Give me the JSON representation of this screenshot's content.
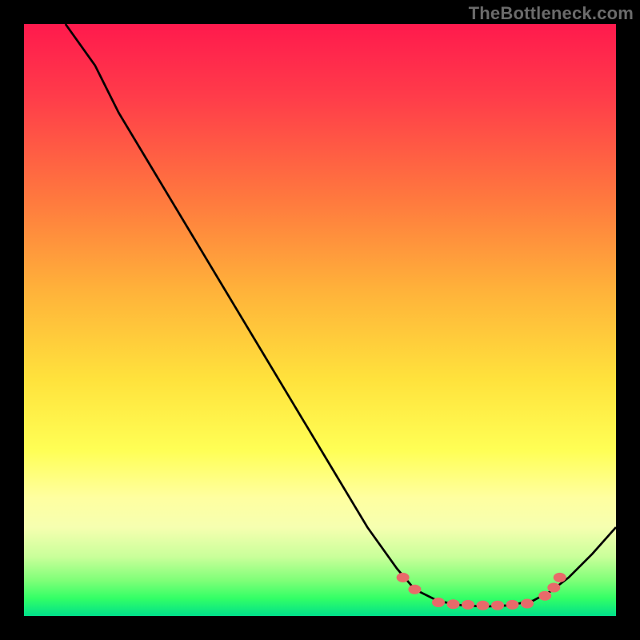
{
  "watermark": "TheBottleneck.com",
  "colors": {
    "curve": "#000000",
    "dot": "#e86a6a",
    "gradient_top": "#ff1a4d",
    "gradient_bottom": "#00e08a"
  },
  "chart_data": {
    "type": "line",
    "title": "",
    "xlabel": "",
    "ylabel": "",
    "xlim": [
      0,
      100
    ],
    "ylim": [
      0,
      100
    ],
    "curve": [
      {
        "x": 7,
        "y": 100
      },
      {
        "x": 12,
        "y": 93
      },
      {
        "x": 16,
        "y": 85
      },
      {
        "x": 22,
        "y": 75
      },
      {
        "x": 28,
        "y": 65
      },
      {
        "x": 34,
        "y": 55
      },
      {
        "x": 40,
        "y": 45
      },
      {
        "x": 46,
        "y": 35
      },
      {
        "x": 52,
        "y": 25
      },
      {
        "x": 58,
        "y": 15
      },
      {
        "x": 63,
        "y": 8
      },
      {
        "x": 66,
        "y": 4.5
      },
      {
        "x": 70,
        "y": 2.5
      },
      {
        "x": 74,
        "y": 1.8
      },
      {
        "x": 78,
        "y": 1.6
      },
      {
        "x": 82,
        "y": 1.8
      },
      {
        "x": 86,
        "y": 2.6
      },
      {
        "x": 89,
        "y": 4.2
      },
      {
        "x": 92,
        "y": 6.5
      },
      {
        "x": 96,
        "y": 10.5
      },
      {
        "x": 100,
        "y": 15
      }
    ],
    "dots": [
      {
        "x": 64,
        "y": 6.5
      },
      {
        "x": 66,
        "y": 4.5
      },
      {
        "x": 70,
        "y": 2.3
      },
      {
        "x": 72.5,
        "y": 2.0
      },
      {
        "x": 75,
        "y": 1.9
      },
      {
        "x": 77.5,
        "y": 1.8
      },
      {
        "x": 80,
        "y": 1.8
      },
      {
        "x": 82.5,
        "y": 1.9
      },
      {
        "x": 85,
        "y": 2.1
      },
      {
        "x": 88,
        "y": 3.4
      },
      {
        "x": 89.5,
        "y": 4.8
      },
      {
        "x": 90.5,
        "y": 6.5
      }
    ]
  }
}
